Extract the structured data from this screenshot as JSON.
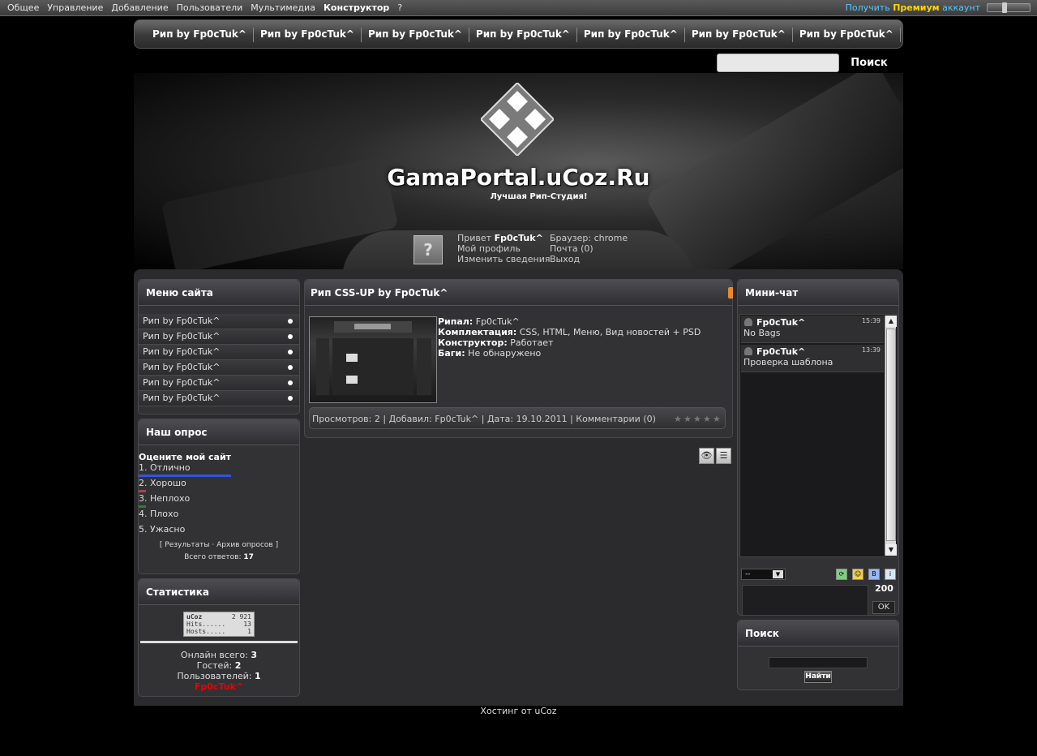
{
  "adminbar": {
    "menu": [
      "Общее",
      "Управление",
      "Добавление",
      "Пользователи",
      "Мультимедиа",
      "Конструктор",
      "?"
    ],
    "premium_prefix": "Получить",
    "premium_bold": "Премиум",
    "premium_suffix": "аккаунт"
  },
  "topnav": [
    "Рип by Fp0cTuk^",
    "Рип by Fp0cTuk^",
    "Рип by Fp0cTuk^",
    "Рип by Fp0cTuk^",
    "Рип by Fp0cTuk^",
    "Рип by Fp0cTuk^",
    "Рип by Fp0cTuk^"
  ],
  "search_top": {
    "button": "Поиск",
    "value": ""
  },
  "header": {
    "site_name": "GamaPortal.uCoz.Ru",
    "slogan": "Лучшая Рип-Студия!",
    "avatar_glyph": "?",
    "greeting": "Привет",
    "username": "Fp0cTuk^",
    "profile": "Мой профиль",
    "edit": "Изменить сведения",
    "browser": "Браузер: chrome",
    "mail": "Почта (0)",
    "logout": "Выход"
  },
  "sitemenu": {
    "title": "Меню сайта",
    "items": [
      "Рип by Fp0cTuk^",
      "Рип by Fp0cTuk^",
      "Рип by Fp0cTuk^",
      "Рип by Fp0cTuk^",
      "Рип by Fp0cTuk^",
      "Рип by Fp0cTuk^"
    ]
  },
  "poll": {
    "title": "Наш опрос",
    "question": "Оцените мой сайт",
    "options": [
      {
        "label": "1. Отлично",
        "share": 0.65,
        "color": "#3355dd"
      },
      {
        "label": "2. Хорошо",
        "share": 0.05,
        "color": "#aa4444"
      },
      {
        "label": "3. Неплохо",
        "share": 0.05,
        "color": "#2e7d32"
      },
      {
        "label": "4. Плохо",
        "share": 0,
        "color": "#777777"
      },
      {
        "label": "5. Ужасно",
        "share": 0,
        "color": "#777777"
      }
    ],
    "links_open": "[",
    "results": "Результаты",
    "sep": "·",
    "archive": "Архив опросов",
    "links_close": "]",
    "total_label": "Всего ответов:",
    "total": "17"
  },
  "stats": {
    "title": "Статистика",
    "counter": {
      "brand": "uCoz",
      "total": "2 921",
      "hits_label": "Hits......",
      "hits": "13",
      "hosts_label": "Hosts.....",
      "hosts": "1"
    },
    "online_label": "Онлайн всего:",
    "online": "3",
    "guests_label": "Гостей:",
    "guests": "2",
    "users_label": "Пользователей:",
    "users": "1",
    "user": "Fp0cTuk^"
  },
  "article": {
    "title": "Рип CSS-UP by Fp0cTuk^",
    "ripper_label": "Рипал:",
    "ripper": "Fp0cTuk^",
    "kit_label": "Комплектация:",
    "kit": "CSS, HTML, Меню, Вид новостей + PSD",
    "builder_label": "Конструктор:",
    "builder": "Работает",
    "bugs_label": "Баги:",
    "bugs": "Не обнаружено",
    "meta": "Просмотров: 2 | Добавил: Fp0cTuk^ | Дата: 19.10.2011 | Комментарии (0)"
  },
  "chat": {
    "title": "Мини-чат",
    "messages": [
      {
        "name": "Fp0cTuk^",
        "time": "15:39",
        "text": "No Bags"
      },
      {
        "name": "Fp0cTuk^",
        "time": "13:39",
        "text": "Проверка шаблона"
      }
    ],
    "select": "--",
    "counter": "200",
    "ok": "OK"
  },
  "search_block": {
    "title": "Поиск",
    "button": "Найти"
  },
  "footer": "Хостинг от uCoz"
}
